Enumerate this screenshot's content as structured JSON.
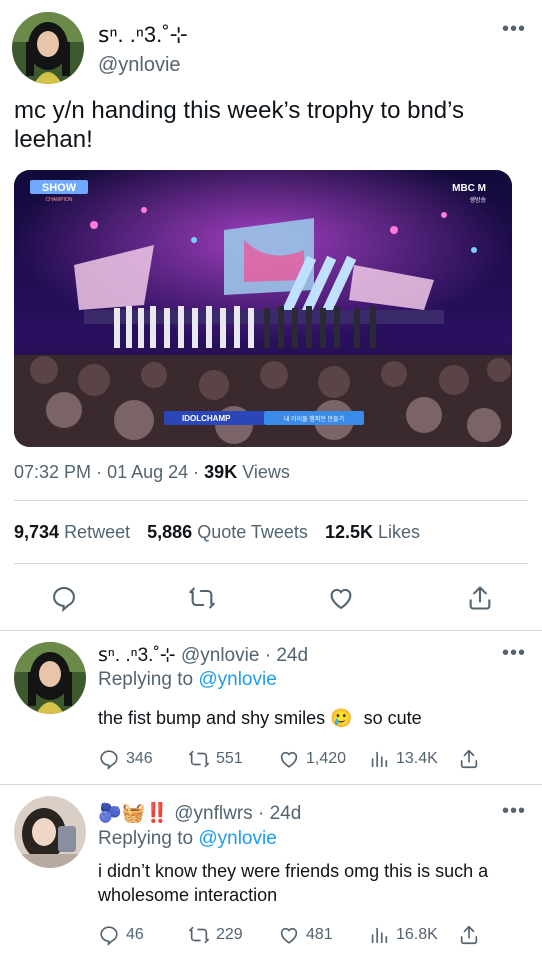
{
  "tweet": {
    "display_name": "ꜱⁿ. .ⁿ3.˚⊹",
    "handle": "@ynlovie",
    "text": "mc y/n handing this week’s trophy to bnd’s leehan!",
    "media": {
      "show_logo": "SHOW",
      "show_logo_sub": "CHAMPION",
      "channel_logo": "MBC M",
      "channel_sub": "생방송",
      "banner_left": "IDOLCHAMP",
      "banner_right": "내 아이돌 챔피언 만들기"
    },
    "time": "07:32 PM",
    "date": "01 Aug 24",
    "views_count": "39K",
    "views_label": "Views",
    "retweets_count": "9,734",
    "retweets_label": "Retweet",
    "quotes_count": "5,886",
    "quotes_label": "Quote Tweets",
    "likes_count": "12.5K",
    "likes_label": "Likes"
  },
  "replies": [
    {
      "display_name": "ꜱⁿ. .ⁿ3.˚⊹",
      "handle": "@ynlovie",
      "age": "24d",
      "replying_label": "Replying to",
      "replying_handle": "@ynlovie",
      "text_before": "the fist bump and shy smiles",
      "emoji": "🥲",
      "text_after": "so cute",
      "replies": "346",
      "retweets": "551",
      "likes": "1,420",
      "views": "13.4K"
    },
    {
      "display_name": "🫐🧺‼️",
      "handle": "@ynflwrs",
      "age": "24d",
      "replying_label": "Replying to",
      "replying_handle": "@ynlovie",
      "text": "i didn’t know they were friends omg this is such a wholesome interaction",
      "replies": "46",
      "retweets": "229",
      "likes": "481",
      "views": "16.8K"
    }
  ],
  "colors": {
    "text": "#0f1419",
    "muted": "#536471",
    "link": "#1d9bf0",
    "divider": "#cfd9de"
  },
  "icons": [
    "more-icon",
    "reply-icon",
    "retweet-icon",
    "like-icon",
    "share-icon",
    "views-icon"
  ]
}
